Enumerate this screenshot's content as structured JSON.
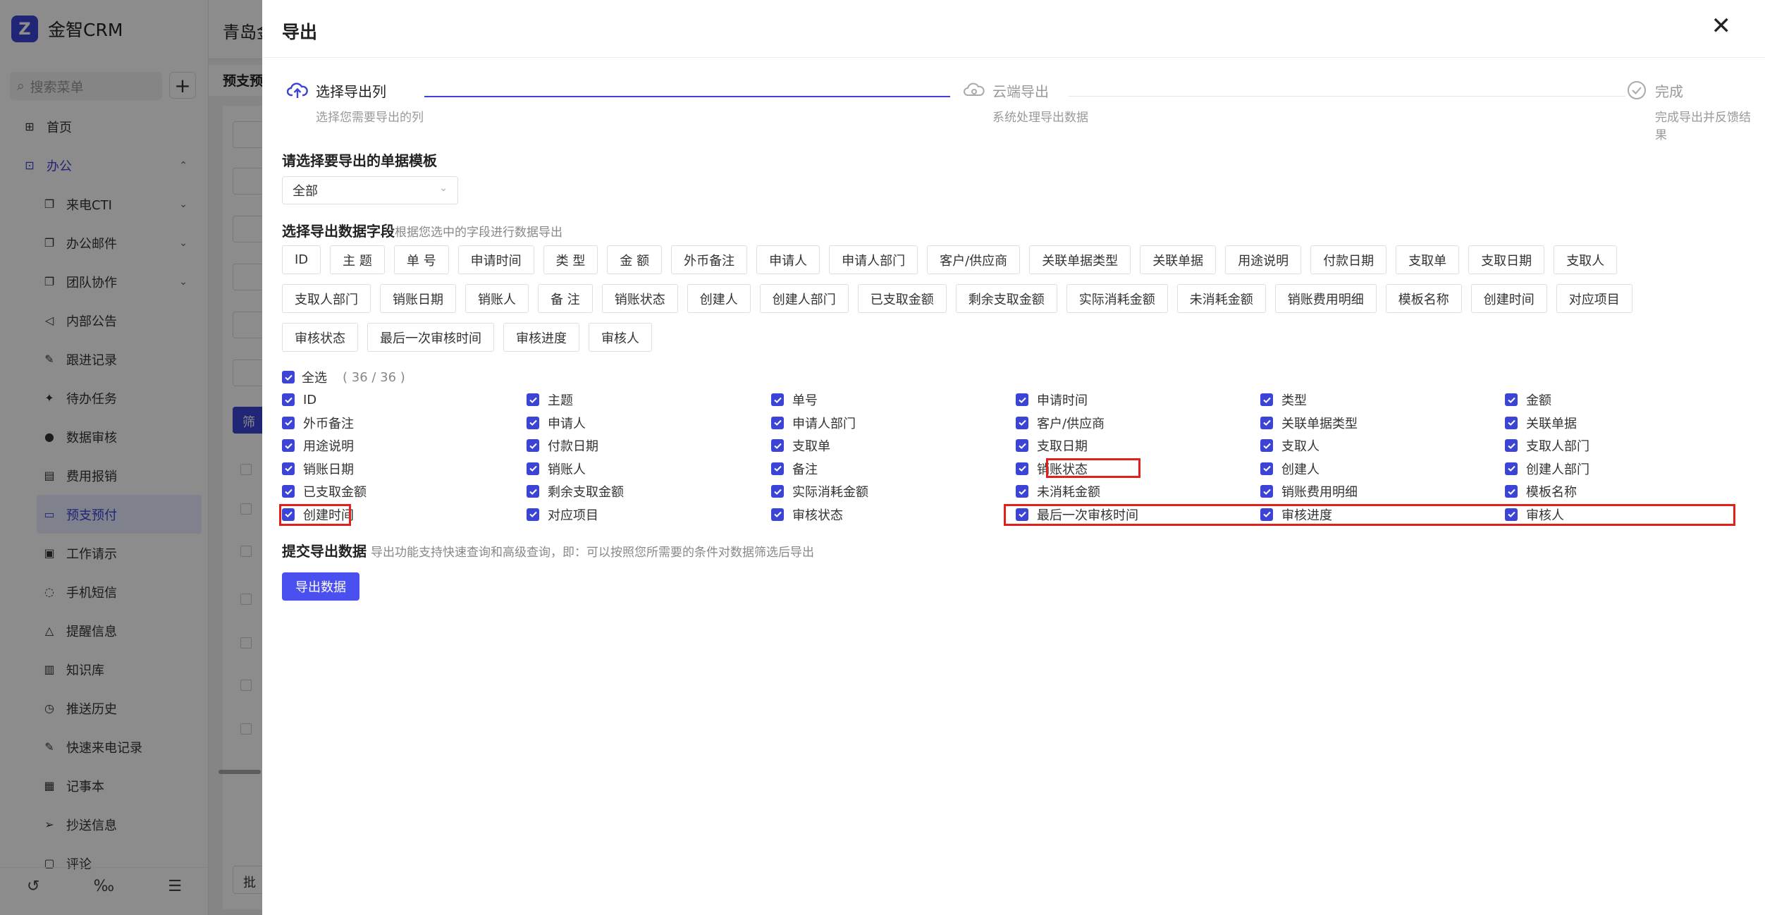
{
  "app": {
    "logo_mark": "Z",
    "name": "金智CRM",
    "header_title": "青岛金",
    "current_tab": "预支预",
    "search_placeholder": "搜索菜单",
    "add_label": "+",
    "filter_btn": "筛",
    "batch_btn": "批",
    "menu": [
      {
        "label": "首页",
        "icon": "home-icon",
        "glyph": "⊞"
      },
      {
        "label": "办公",
        "icon": "office-icon",
        "glyph": "⊡",
        "expanded": true
      },
      {
        "label": "来电CTI",
        "icon": "copy-icon",
        "glyph": "❐",
        "chevron": "⌄"
      },
      {
        "label": "办公邮件",
        "icon": "copy-icon",
        "glyph": "❐",
        "chevron": "⌄"
      },
      {
        "label": "团队协作",
        "icon": "copy-icon",
        "glyph": "❐",
        "chevron": "⌄"
      },
      {
        "label": "内部公告",
        "icon": "speaker-icon",
        "glyph": "◁"
      },
      {
        "label": "跟进记录",
        "icon": "edit-doc-icon",
        "glyph": "✎"
      },
      {
        "label": "待办任务",
        "icon": "pin-icon",
        "glyph": "✦"
      },
      {
        "label": "数据审核",
        "icon": "user-icon",
        "glyph": "●"
      },
      {
        "label": "费用报销",
        "icon": "doc-icon",
        "glyph": "▤"
      },
      {
        "label": "预支预付",
        "icon": "card-icon",
        "glyph": "▭",
        "active": true
      },
      {
        "label": "工作请示",
        "icon": "request-icon",
        "glyph": "▣"
      },
      {
        "label": "手机短信",
        "icon": "message-icon",
        "glyph": "◌"
      },
      {
        "label": "提醒信息",
        "icon": "bell-icon",
        "glyph": "△"
      },
      {
        "label": "知识库",
        "icon": "book-icon",
        "glyph": "▥"
      },
      {
        "label": "推送历史",
        "icon": "clock-icon",
        "glyph": "◷"
      },
      {
        "label": "快速来电记录",
        "icon": "edit-doc-icon",
        "glyph": "✎"
      },
      {
        "label": "记事本",
        "icon": "notebook-icon",
        "glyph": "▦"
      },
      {
        "label": "抄送信息",
        "icon": "send-icon",
        "glyph": "➢"
      },
      {
        "label": "评论",
        "icon": "comment-icon",
        "glyph": "▢"
      }
    ],
    "bottom_icons": [
      {
        "name": "history-icon",
        "glyph": "↺"
      },
      {
        "name": "percent-icon",
        "glyph": "‰"
      },
      {
        "name": "collapse-menu-icon",
        "glyph": "☰"
      }
    ]
  },
  "drawer": {
    "title": "导出",
    "close": "✕",
    "steps": [
      {
        "title": "选择导出列",
        "desc": "选择您需要导出的列",
        "icon": "cloud-upload-icon",
        "status": "active"
      },
      {
        "title": "云端导出",
        "desc": "系统处理导出数据",
        "icon": "cloud-icon",
        "status": "wait"
      },
      {
        "title": "完成",
        "desc": "完成导出并反馈结果",
        "icon": "check-circle-icon",
        "status": "wait"
      }
    ],
    "template_label": "请选择要导出的单据模板",
    "template_value": "全部",
    "fields_label": "选择导出数据字段",
    "fields_hint": "根据您选中的字段进行数据导出",
    "tag_rows": [
      [
        "ID",
        "主 题",
        "单 号",
        "申请时间",
        "类 型",
        "金 额",
        "外币备注",
        "申请人",
        "申请人部门",
        "客户/供应商",
        "关联单据类型",
        "关联单据",
        "用途说明",
        "付款日期",
        "支取单",
        "支取日期",
        "支取人"
      ],
      [
        "支取人部门",
        "销账日期",
        "销账人",
        "备 注",
        "销账状态",
        "创建人",
        "创建人部门",
        "已支取金额",
        "剩余支取金额",
        "实际消耗金额",
        "未消耗金额",
        "销账费用明细",
        "模板名称",
        "创建时间",
        "对应项目"
      ],
      [
        "审核状态",
        "最后一次审核时间",
        "审核进度",
        "审核人"
      ]
    ],
    "select_all_label": "全选",
    "select_count": "( 36 / 36 )",
    "checkbox_rows": [
      [
        "ID",
        "主题",
        "单号",
        "申请时间",
        "类型",
        "金额"
      ],
      [
        "外币备注",
        "申请人",
        "申请人部门",
        "客户/供应商",
        "关联单据类型",
        "关联单据"
      ],
      [
        "用途说明",
        "付款日期",
        "支取单",
        "支取日期",
        "支取人",
        "支取人部门"
      ],
      [
        "销账日期",
        "销账人",
        "备注",
        "销账状态",
        "创建人",
        "创建人部门"
      ],
      [
        "已支取金额",
        "剩余支取金额",
        "实际消耗金额",
        "未消耗金额",
        "销账费用明细",
        "模板名称"
      ],
      [
        "创建时间",
        "对应项目",
        "审核状态",
        "最后一次审核时间",
        "审核进度",
        "审核人"
      ]
    ],
    "submit_label": "提交导出数据",
    "submit_hint": "导出功能支持快速查询和高级查询，即：可以按照您所需要的条件对数据筛选后导出",
    "export_button": "导出数据"
  },
  "colors": {
    "primary": "#3b44d6",
    "highlight": "#e0201a"
  }
}
